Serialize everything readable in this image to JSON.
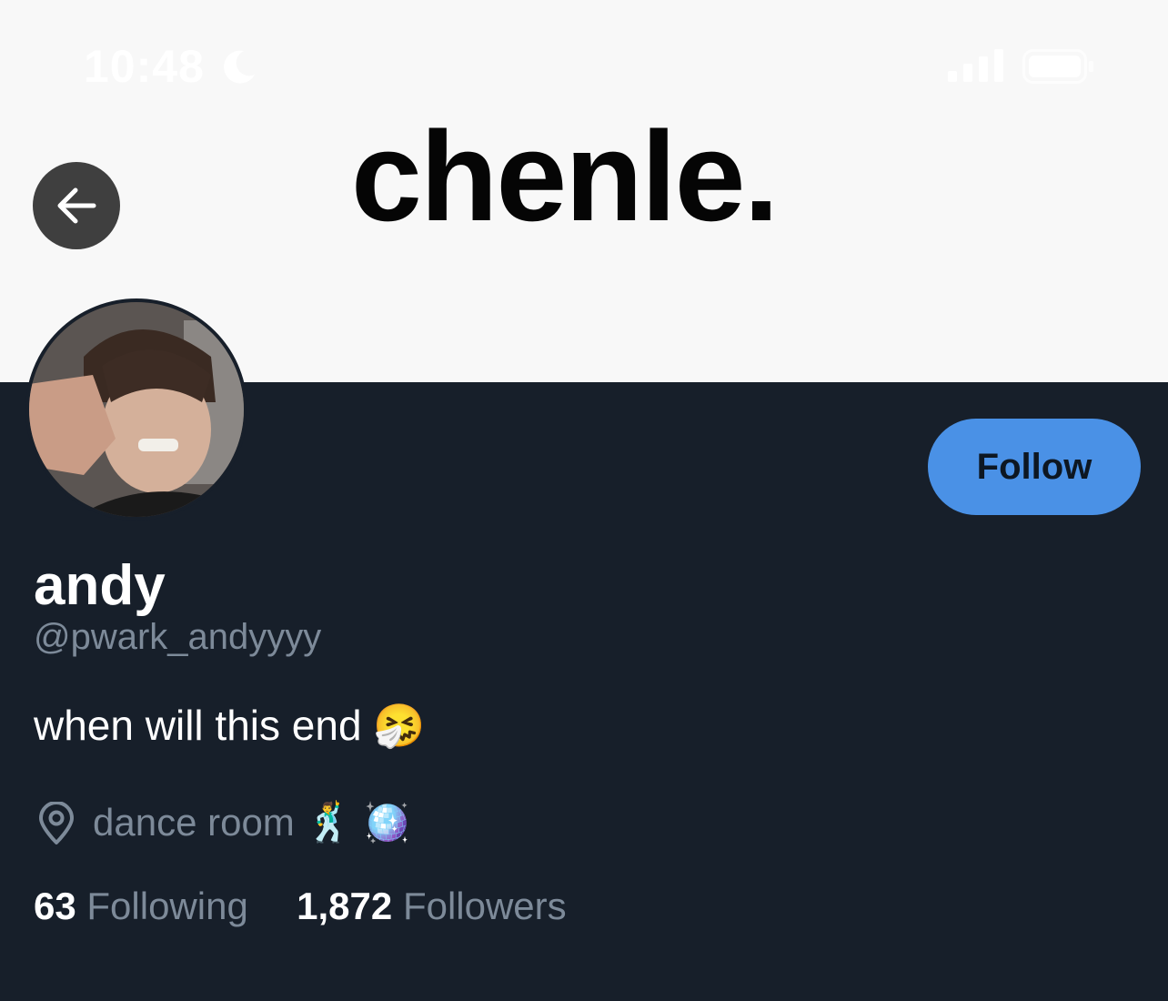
{
  "status_bar": {
    "time": "10:48",
    "icons": [
      "moon-icon",
      "signal-icon",
      "battery-icon"
    ]
  },
  "banner": {
    "title": "chenle.",
    "back_icon": "arrow-left-icon"
  },
  "profile": {
    "avatar": "avatar",
    "follow_label": "Follow",
    "name": "andy",
    "handle": "@pwark_andyyyy",
    "bio": "when will this end 🤧",
    "location_icon": "location-pin-icon",
    "location": "dance room 🕺 🪩",
    "following_count": "63",
    "following_label": "Following",
    "followers_count": "1,872",
    "followers_label": "Followers"
  },
  "colors": {
    "background": "#171f2a",
    "banner": "#f8f8f8",
    "accent": "#4a91e6",
    "muted_text": "#7d8a99"
  }
}
